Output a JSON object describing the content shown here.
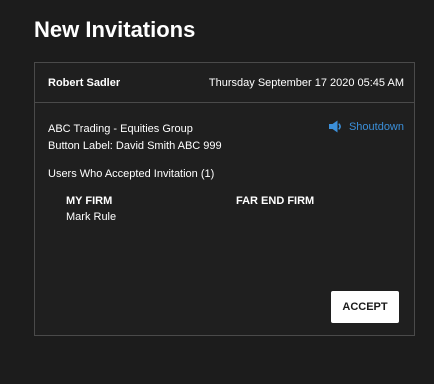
{
  "page": {
    "title": "New Invitations"
  },
  "invitation": {
    "sender": "Robert Sadler",
    "timestamp": "Thursday September 17 2020 05:45 AM",
    "group": "ABC Trading - Equities Group",
    "button_label": "Button Label: David Smith ABC 999",
    "shoutdown": {
      "label": "Shoutdown",
      "icon": "speaker-icon",
      "color": "#3b8fd9"
    },
    "accepted_heading": "Users Who Accepted Invitation (1)",
    "columns": {
      "my_firm": "MY FIRM",
      "far_end_firm": "FAR END FIRM"
    },
    "my_firm_users": [
      "Mark Rule"
    ],
    "accept_label": "ACCEPT"
  }
}
